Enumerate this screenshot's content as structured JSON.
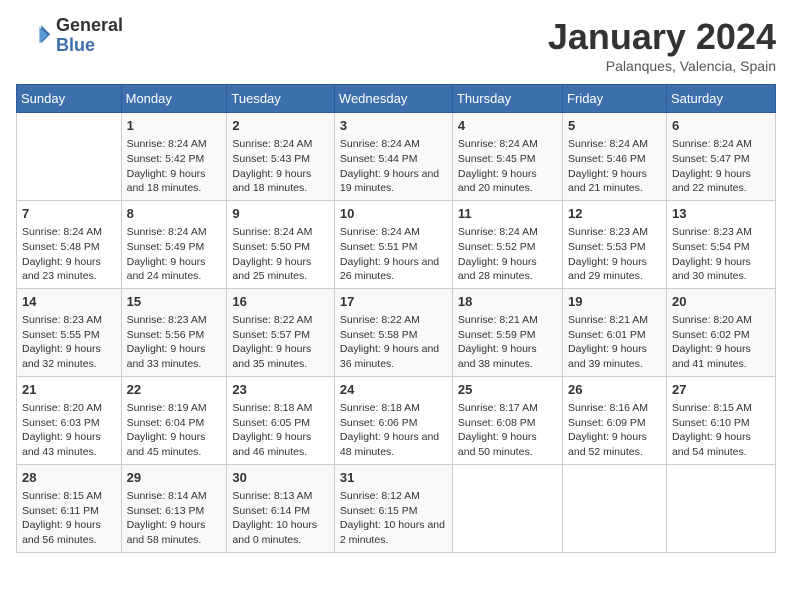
{
  "header": {
    "logo_general": "General",
    "logo_blue": "Blue",
    "title": "January 2024",
    "subtitle": "Palanques, Valencia, Spain"
  },
  "weekdays": [
    "Sunday",
    "Monday",
    "Tuesday",
    "Wednesday",
    "Thursday",
    "Friday",
    "Saturday"
  ],
  "weeks": [
    [
      {
        "day": "",
        "sunrise": "",
        "sunset": "",
        "daylight": ""
      },
      {
        "day": "1",
        "sunrise": "Sunrise: 8:24 AM",
        "sunset": "Sunset: 5:42 PM",
        "daylight": "Daylight: 9 hours and 18 minutes."
      },
      {
        "day": "2",
        "sunrise": "Sunrise: 8:24 AM",
        "sunset": "Sunset: 5:43 PM",
        "daylight": "Daylight: 9 hours and 18 minutes."
      },
      {
        "day": "3",
        "sunrise": "Sunrise: 8:24 AM",
        "sunset": "Sunset: 5:44 PM",
        "daylight": "Daylight: 9 hours and 19 minutes."
      },
      {
        "day": "4",
        "sunrise": "Sunrise: 8:24 AM",
        "sunset": "Sunset: 5:45 PM",
        "daylight": "Daylight: 9 hours and 20 minutes."
      },
      {
        "day": "5",
        "sunrise": "Sunrise: 8:24 AM",
        "sunset": "Sunset: 5:46 PM",
        "daylight": "Daylight: 9 hours and 21 minutes."
      },
      {
        "day": "6",
        "sunrise": "Sunrise: 8:24 AM",
        "sunset": "Sunset: 5:47 PM",
        "daylight": "Daylight: 9 hours and 22 minutes."
      }
    ],
    [
      {
        "day": "7",
        "sunrise": "Sunrise: 8:24 AM",
        "sunset": "Sunset: 5:48 PM",
        "daylight": "Daylight: 9 hours and 23 minutes."
      },
      {
        "day": "8",
        "sunrise": "Sunrise: 8:24 AM",
        "sunset": "Sunset: 5:49 PM",
        "daylight": "Daylight: 9 hours and 24 minutes."
      },
      {
        "day": "9",
        "sunrise": "Sunrise: 8:24 AM",
        "sunset": "Sunset: 5:50 PM",
        "daylight": "Daylight: 9 hours and 25 minutes."
      },
      {
        "day": "10",
        "sunrise": "Sunrise: 8:24 AM",
        "sunset": "Sunset: 5:51 PM",
        "daylight": "Daylight: 9 hours and 26 minutes."
      },
      {
        "day": "11",
        "sunrise": "Sunrise: 8:24 AM",
        "sunset": "Sunset: 5:52 PM",
        "daylight": "Daylight: 9 hours and 28 minutes."
      },
      {
        "day": "12",
        "sunrise": "Sunrise: 8:23 AM",
        "sunset": "Sunset: 5:53 PM",
        "daylight": "Daylight: 9 hours and 29 minutes."
      },
      {
        "day": "13",
        "sunrise": "Sunrise: 8:23 AM",
        "sunset": "Sunset: 5:54 PM",
        "daylight": "Daylight: 9 hours and 30 minutes."
      }
    ],
    [
      {
        "day": "14",
        "sunrise": "Sunrise: 8:23 AM",
        "sunset": "Sunset: 5:55 PM",
        "daylight": "Daylight: 9 hours and 32 minutes."
      },
      {
        "day": "15",
        "sunrise": "Sunrise: 8:23 AM",
        "sunset": "Sunset: 5:56 PM",
        "daylight": "Daylight: 9 hours and 33 minutes."
      },
      {
        "day": "16",
        "sunrise": "Sunrise: 8:22 AM",
        "sunset": "Sunset: 5:57 PM",
        "daylight": "Daylight: 9 hours and 35 minutes."
      },
      {
        "day": "17",
        "sunrise": "Sunrise: 8:22 AM",
        "sunset": "Sunset: 5:58 PM",
        "daylight": "Daylight: 9 hours and 36 minutes."
      },
      {
        "day": "18",
        "sunrise": "Sunrise: 8:21 AM",
        "sunset": "Sunset: 5:59 PM",
        "daylight": "Daylight: 9 hours and 38 minutes."
      },
      {
        "day": "19",
        "sunrise": "Sunrise: 8:21 AM",
        "sunset": "Sunset: 6:01 PM",
        "daylight": "Daylight: 9 hours and 39 minutes."
      },
      {
        "day": "20",
        "sunrise": "Sunrise: 8:20 AM",
        "sunset": "Sunset: 6:02 PM",
        "daylight": "Daylight: 9 hours and 41 minutes."
      }
    ],
    [
      {
        "day": "21",
        "sunrise": "Sunrise: 8:20 AM",
        "sunset": "Sunset: 6:03 PM",
        "daylight": "Daylight: 9 hours and 43 minutes."
      },
      {
        "day": "22",
        "sunrise": "Sunrise: 8:19 AM",
        "sunset": "Sunset: 6:04 PM",
        "daylight": "Daylight: 9 hours and 45 minutes."
      },
      {
        "day": "23",
        "sunrise": "Sunrise: 8:18 AM",
        "sunset": "Sunset: 6:05 PM",
        "daylight": "Daylight: 9 hours and 46 minutes."
      },
      {
        "day": "24",
        "sunrise": "Sunrise: 8:18 AM",
        "sunset": "Sunset: 6:06 PM",
        "daylight": "Daylight: 9 hours and 48 minutes."
      },
      {
        "day": "25",
        "sunrise": "Sunrise: 8:17 AM",
        "sunset": "Sunset: 6:08 PM",
        "daylight": "Daylight: 9 hours and 50 minutes."
      },
      {
        "day": "26",
        "sunrise": "Sunrise: 8:16 AM",
        "sunset": "Sunset: 6:09 PM",
        "daylight": "Daylight: 9 hours and 52 minutes."
      },
      {
        "day": "27",
        "sunrise": "Sunrise: 8:15 AM",
        "sunset": "Sunset: 6:10 PM",
        "daylight": "Daylight: 9 hours and 54 minutes."
      }
    ],
    [
      {
        "day": "28",
        "sunrise": "Sunrise: 8:15 AM",
        "sunset": "Sunset: 6:11 PM",
        "daylight": "Daylight: 9 hours and 56 minutes."
      },
      {
        "day": "29",
        "sunrise": "Sunrise: 8:14 AM",
        "sunset": "Sunset: 6:13 PM",
        "daylight": "Daylight: 9 hours and 58 minutes."
      },
      {
        "day": "30",
        "sunrise": "Sunrise: 8:13 AM",
        "sunset": "Sunset: 6:14 PM",
        "daylight": "Daylight: 10 hours and 0 minutes."
      },
      {
        "day": "31",
        "sunrise": "Sunrise: 8:12 AM",
        "sunset": "Sunset: 6:15 PM",
        "daylight": "Daylight: 10 hours and 2 minutes."
      },
      {
        "day": "",
        "sunrise": "",
        "sunset": "",
        "daylight": ""
      },
      {
        "day": "",
        "sunrise": "",
        "sunset": "",
        "daylight": ""
      },
      {
        "day": "",
        "sunrise": "",
        "sunset": "",
        "daylight": ""
      }
    ]
  ]
}
